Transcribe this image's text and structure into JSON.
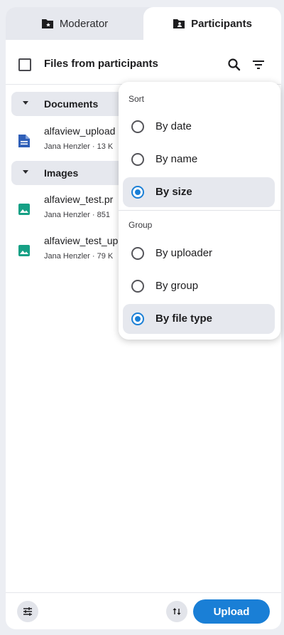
{
  "tabs": {
    "moderator": "Moderator",
    "participants": "Participants",
    "active": "participants"
  },
  "files_header": {
    "title": "Files from participants",
    "icons": [
      "search-icon",
      "filter-list-icon"
    ]
  },
  "groups": [
    {
      "label": "Documents",
      "files": [
        {
          "name": "alfaview_upload",
          "meta": "Jana Henzler · 13 K",
          "icon": "document-icon"
        }
      ]
    },
    {
      "label": "Images",
      "files": [
        {
          "name": "alfaview_test.pr",
          "meta": "Jana Henzler · 851",
          "icon": "image-icon"
        },
        {
          "name": "alfaview_test_up",
          "meta": "Jana Henzler · 79 K",
          "icon": "image-icon"
        }
      ]
    }
  ],
  "menu": {
    "sort_label": "Sort",
    "sort_options": [
      "By date",
      "By name",
      "By size"
    ],
    "sort_selected": "By size",
    "group_label": "Group",
    "group_options": [
      "By uploader",
      "By group",
      "By file type"
    ],
    "group_selected": "By file type"
  },
  "footer": {
    "upload_label": "Upload",
    "icons": [
      "settings-sliders-icon",
      "sort-arrows-icon"
    ]
  },
  "colors": {
    "accent": "#1a7fd6",
    "document_icon": "#2f5fb8",
    "image_icon": "#16a085",
    "background": "#eceef3"
  }
}
